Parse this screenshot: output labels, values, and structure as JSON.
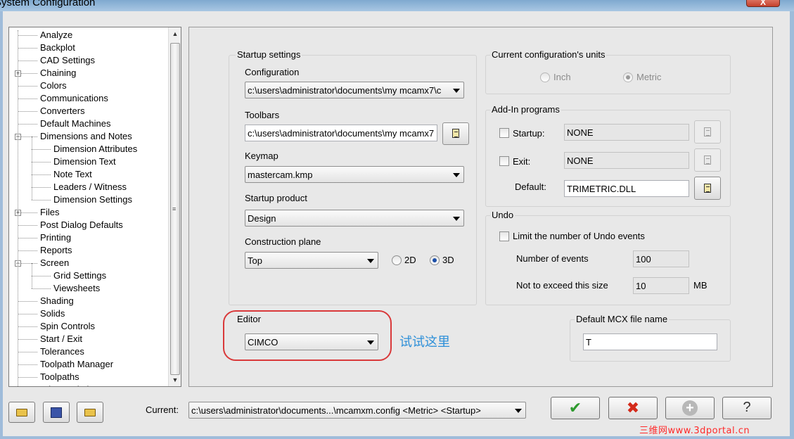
{
  "window": {
    "title": "System Configuration",
    "close_label": "X"
  },
  "tree": {
    "items": [
      {
        "label": "Analyze"
      },
      {
        "label": "Backplot"
      },
      {
        "label": "CAD Settings"
      },
      {
        "label": "Chaining"
      },
      {
        "label": "Colors"
      },
      {
        "label": "Communications"
      },
      {
        "label": "Converters"
      },
      {
        "label": "Default Machines"
      },
      {
        "label": "Dimensions and Notes"
      },
      {
        "label": "Dimension Attributes"
      },
      {
        "label": "Dimension Text"
      },
      {
        "label": "Note Text"
      },
      {
        "label": "Leaders / Witness"
      },
      {
        "label": "Dimension Settings"
      },
      {
        "label": "Files"
      },
      {
        "label": "Post Dialog Defaults"
      },
      {
        "label": "Printing"
      },
      {
        "label": "Reports"
      },
      {
        "label": "Screen"
      },
      {
        "label": "Grid Settings"
      },
      {
        "label": "Viewsheets"
      },
      {
        "label": "Shading"
      },
      {
        "label": "Solids"
      },
      {
        "label": "Spin Controls"
      },
      {
        "label": "Start / Exit"
      },
      {
        "label": "Tolerances"
      },
      {
        "label": "Toolpath Manager"
      },
      {
        "label": "Toolpaths"
      },
      {
        "label": "Wire Backplot"
      }
    ]
  },
  "startup": {
    "group_title": "Startup settings",
    "configuration_label": "Configuration",
    "configuration_value": "c:\\users\\administrator\\documents\\my mcamx7\\c",
    "toolbars_label": "Toolbars",
    "toolbars_value": "c:\\users\\administrator\\documents\\my mcamx7",
    "keymap_label": "Keymap",
    "keymap_value": "mastercam.kmp",
    "product_label": "Startup product",
    "product_value": "Design",
    "plane_label": "Construction plane",
    "plane_value": "Top",
    "plane_2d": "2D",
    "plane_3d": "3D"
  },
  "units": {
    "group_title": "Current configuration's units",
    "inch": "Inch",
    "metric": "Metric"
  },
  "addins": {
    "group_title": "Add-In programs",
    "startup_label": "Startup:",
    "startup_value": "NONE",
    "exit_label": "Exit:",
    "exit_value": "NONE",
    "default_label": "Default:",
    "default_value": "TRIMETRIC.DLL"
  },
  "undo": {
    "group_title": "Undo",
    "limit_label": "Limit the number of Undo events",
    "events_label": "Number of events",
    "events_value": "100",
    "size_label": "Not to exceed this size",
    "size_value": "10",
    "size_unit": "MB"
  },
  "editor": {
    "group_title": "Editor",
    "value": "CIMCO",
    "annotation": "试试这里"
  },
  "mcx": {
    "group_title": "Default MCX file name",
    "value": "T"
  },
  "bottom": {
    "current_label": "Current:",
    "current_value": "c:\\users\\administrator\\documents...\\mcamxm.config <Metric> <Startup>",
    "ok_symbol": "✔",
    "cancel_symbol": "✖",
    "add_symbol": "+",
    "help_symbol": "?",
    "watermark": "三维网www.3dportal.cn"
  },
  "colors": {
    "ok_green": "#2e9a2e",
    "cancel_red": "#d42a1a",
    "highlight_red": "#d9393a",
    "annotation_blue": "#2d8fd8"
  }
}
